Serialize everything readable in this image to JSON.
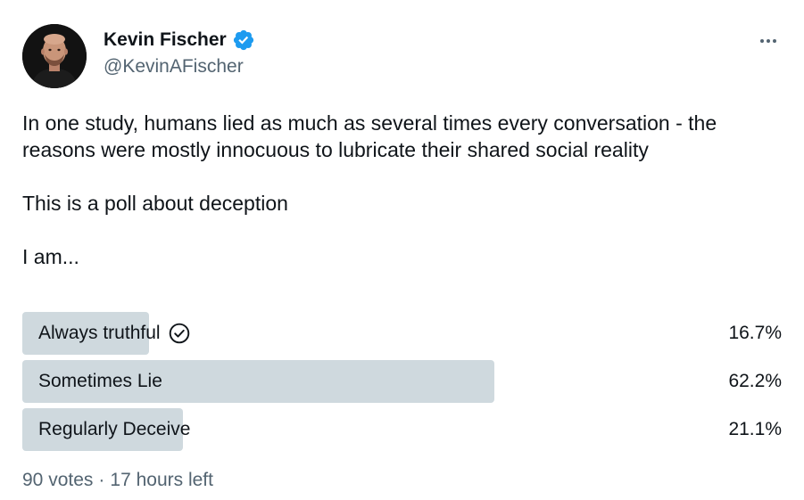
{
  "author": {
    "display_name": "Kevin Fischer",
    "handle": "@KevinAFischer",
    "verified": true,
    "avatar_icon": "profile-photo"
  },
  "tweet": {
    "paragraphs": [
      "In one study, humans lied as much as several times every conversation - the reasons were mostly innocuous to lubricate their shared social reality",
      "This is a poll about deception",
      "I am..."
    ]
  },
  "poll": {
    "options": [
      {
        "label": "Always truthful",
        "percent": "16.7%",
        "fraction": 0.167,
        "selected": true
      },
      {
        "label": "Sometimes Lie",
        "percent": "62.2%",
        "fraction": 0.622,
        "selected": false
      },
      {
        "label": "Regularly Deceive",
        "percent": "21.1%",
        "fraction": 0.211,
        "selected": false
      }
    ],
    "votes": "90 votes",
    "separator": "·",
    "time_left": "17 hours left"
  },
  "colors": {
    "verified_blue": "#1d9bf0",
    "bar_fill": "#cfd9de",
    "muted_text": "#536471",
    "primary_text": "#0f1419"
  },
  "icons": {
    "verified": "verified-badge-icon",
    "more": "more-dots-icon",
    "selected_choice": "check-circle-icon"
  }
}
